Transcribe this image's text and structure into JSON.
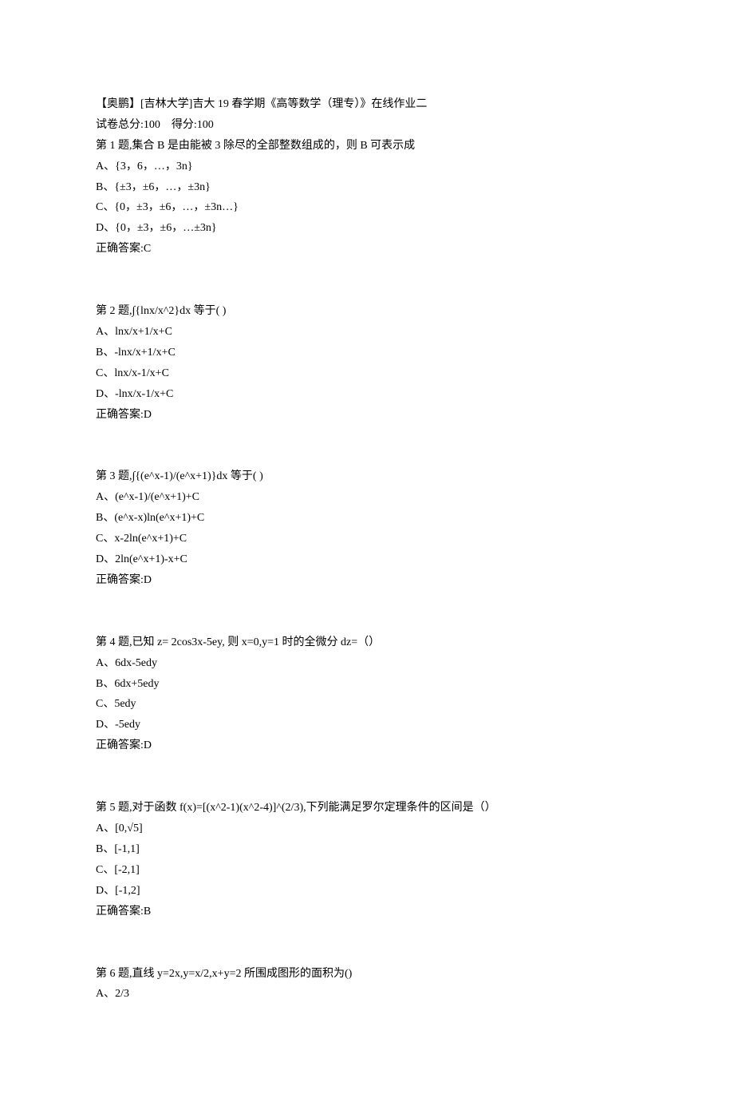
{
  "header": {
    "title": "【奥鹏】[吉林大学]吉大 19 春学期《高等数学（理专）》在线作业二",
    "score_line": "试卷总分:100    得分:100"
  },
  "questions": [
    {
      "prompt": "第 1 题,集合 B 是由能被 3 除尽的全部整数组成的，则 B 可表示成",
      "options": [
        "A、{3，6，…，3n}",
        "B、{±3，±6，…，±3n}",
        "C、{0，±3，±6，…，±3n…}",
        "D、{0，±3，±6，…±3n}"
      ],
      "answer": "正确答案:C"
    },
    {
      "prompt": "第 2 题,∫{lnx/x^2}dx 等于( )",
      "options": [
        "A、lnx/x+1/x+C",
        "B、-lnx/x+1/x+C",
        "C、lnx/x-1/x+C",
        "D、-lnx/x-1/x+C"
      ],
      "answer": "正确答案:D"
    },
    {
      "prompt": "第 3 题,∫{(e^x-1)/(e^x+1)}dx 等于( )",
      "options": [
        "A、(e^x-1)/(e^x+1)+C",
        "B、(e^x-x)ln(e^x+1)+C",
        "C、x-2ln(e^x+1)+C",
        "D、2ln(e^x+1)-x+C"
      ],
      "answer": "正确答案:D"
    },
    {
      "prompt": "第 4 题,已知 z= 2cos3x-5ey, 则 x=0,y=1 时的全微分 dz=（）",
      "options": [
        "A、6dx-5edy",
        "B、6dx+5edy",
        "C、5edy",
        "D、-5edy"
      ],
      "answer": "正确答案:D"
    },
    {
      "prompt": "第 5 题,对于函数 f(x)=[(x^2-1)(x^2-4)]^(2/3),下列能满足罗尔定理条件的区间是（）",
      "options": [
        "A、[0,√5]",
        "B、[-1,1]",
        "C、[-2,1]",
        "D、[-1,2]"
      ],
      "answer": "正确答案:B"
    },
    {
      "prompt": "第 6 题,直线 y=2x,y=x/2,x+y=2 所围成图形的面积为()",
      "options": [
        "A、2/3"
      ],
      "answer": ""
    }
  ]
}
